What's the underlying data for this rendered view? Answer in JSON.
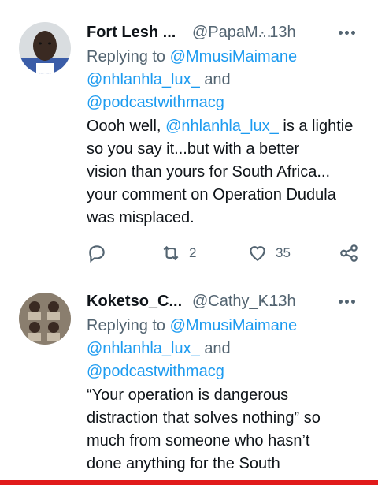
{
  "tweets": [
    {
      "name": "Fort Lesh ...",
      "handle": "@PapaM...",
      "time": "· 13h",
      "replying_label": "Replying to",
      "reply_to": [
        "@MmusiMaimane",
        "@nhlanhla_lux_",
        "and",
        "@podcastwithmacg"
      ],
      "text_parts": [
        "Oooh well,",
        "@nhlanhla_lux_",
        "is a lightie",
        "so you say it...but with a better",
        "vision than yours for South Africa...",
        "your comment on Operation Dudula",
        "was misplaced."
      ],
      "retweets": "2",
      "likes": "35"
    },
    {
      "name": "Koketso_C...",
      "handle": "@Cathy_K...",
      "time": "· 13h",
      "replying_label": "Replying to",
      "reply_to": [
        "@MmusiMaimane",
        "@nhlanhla_lux_",
        "and",
        "@podcastwithmacg"
      ],
      "text_lines": [
        "“Your operation is dangerous",
        "distraction that solves nothing” so",
        "much from someone who hasn’t",
        "done anything for the South"
      ]
    }
  ],
  "icons": [
    "reply-icon",
    "retweet-icon",
    "like-icon",
    "share-icon",
    "more-icon"
  ],
  "colors": {
    "link": "#1d9bf0",
    "muted": "#536471",
    "text": "#0f1419",
    "bottom_bar": "#e11b1b"
  }
}
